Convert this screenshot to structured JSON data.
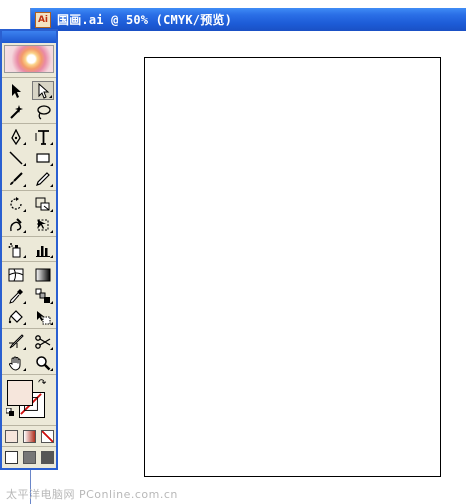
{
  "document": {
    "title": "国画.ai @ 50% (CMYK/预览)",
    "icon_label": "Ai",
    "icon": "illustrator-doc-icon"
  },
  "toolbox": {
    "rows": [
      [
        "selection-tool-icon",
        "direct-selection-tool-icon"
      ],
      [
        "magic-wand-tool-icon",
        "lasso-tool-icon"
      ],
      [
        "pen-tool-icon",
        "type-tool-icon"
      ],
      [
        "line-segment-tool-icon",
        "rectangle-tool-icon"
      ],
      [
        "paintbrush-tool-icon",
        "pencil-tool-icon"
      ],
      [
        "rotate-tool-icon",
        "scale-tool-icon"
      ],
      [
        "warp-tool-icon",
        "free-transform-tool-icon"
      ],
      [
        "symbol-sprayer-tool-icon",
        "column-graph-tool-icon"
      ],
      [
        "mesh-tool-icon",
        "gradient-tool-icon"
      ],
      [
        "eyedropper-tool-icon",
        "blend-tool-icon"
      ],
      [
        "live-paint-bucket-tool-icon",
        "live-paint-selection-tool-icon"
      ],
      [
        "slice-tool-icon",
        "scissors-tool-icon"
      ],
      [
        "hand-tool-icon",
        "zoom-tool-icon"
      ]
    ],
    "selected_tool": "direct-selection-tool-icon",
    "fill_color": "#f6e6dc",
    "stroke_color": "none"
  },
  "watermark": "太平洋电脑网 PConline.com.cn"
}
